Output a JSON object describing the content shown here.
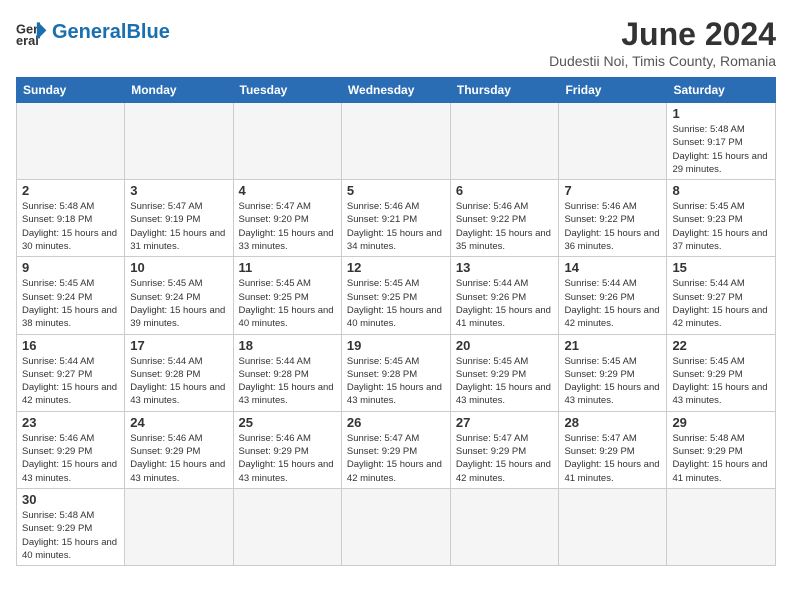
{
  "logo": {
    "general": "General",
    "blue": "Blue"
  },
  "header": {
    "title": "June 2024",
    "subtitle": "Dudestii Noi, Timis County, Romania"
  },
  "days_of_week": [
    "Sunday",
    "Monday",
    "Tuesday",
    "Wednesday",
    "Thursday",
    "Friday",
    "Saturday"
  ],
  "weeks": [
    [
      {
        "day": null
      },
      {
        "day": null
      },
      {
        "day": null
      },
      {
        "day": null
      },
      {
        "day": null
      },
      {
        "day": null
      },
      {
        "day": 1,
        "sunrise": "5:48 AM",
        "sunset": "9:17 PM",
        "daylight": "15 hours and 29 minutes."
      }
    ],
    [
      {
        "day": 2,
        "sunrise": "5:48 AM",
        "sunset": "9:18 PM",
        "daylight": "15 hours and 30 minutes."
      },
      {
        "day": 3,
        "sunrise": "5:47 AM",
        "sunset": "9:19 PM",
        "daylight": "15 hours and 31 minutes."
      },
      {
        "day": 4,
        "sunrise": "5:47 AM",
        "sunset": "9:20 PM",
        "daylight": "15 hours and 33 minutes."
      },
      {
        "day": 5,
        "sunrise": "5:46 AM",
        "sunset": "9:21 PM",
        "daylight": "15 hours and 34 minutes."
      },
      {
        "day": 6,
        "sunrise": "5:46 AM",
        "sunset": "9:22 PM",
        "daylight": "15 hours and 35 minutes."
      },
      {
        "day": 7,
        "sunrise": "5:46 AM",
        "sunset": "9:22 PM",
        "daylight": "15 hours and 36 minutes."
      },
      {
        "day": 8,
        "sunrise": "5:45 AM",
        "sunset": "9:23 PM",
        "daylight": "15 hours and 37 minutes."
      }
    ],
    [
      {
        "day": 9,
        "sunrise": "5:45 AM",
        "sunset": "9:24 PM",
        "daylight": "15 hours and 38 minutes."
      },
      {
        "day": 10,
        "sunrise": "5:45 AM",
        "sunset": "9:24 PM",
        "daylight": "15 hours and 39 minutes."
      },
      {
        "day": 11,
        "sunrise": "5:45 AM",
        "sunset": "9:25 PM",
        "daylight": "15 hours and 40 minutes."
      },
      {
        "day": 12,
        "sunrise": "5:45 AM",
        "sunset": "9:25 PM",
        "daylight": "15 hours and 40 minutes."
      },
      {
        "day": 13,
        "sunrise": "5:44 AM",
        "sunset": "9:26 PM",
        "daylight": "15 hours and 41 minutes."
      },
      {
        "day": 14,
        "sunrise": "5:44 AM",
        "sunset": "9:26 PM",
        "daylight": "15 hours and 42 minutes."
      },
      {
        "day": 15,
        "sunrise": "5:44 AM",
        "sunset": "9:27 PM",
        "daylight": "15 hours and 42 minutes."
      }
    ],
    [
      {
        "day": 16,
        "sunrise": "5:44 AM",
        "sunset": "9:27 PM",
        "daylight": "15 hours and 42 minutes."
      },
      {
        "day": 17,
        "sunrise": "5:44 AM",
        "sunset": "9:28 PM",
        "daylight": "15 hours and 43 minutes."
      },
      {
        "day": 18,
        "sunrise": "5:44 AM",
        "sunset": "9:28 PM",
        "daylight": "15 hours and 43 minutes."
      },
      {
        "day": 19,
        "sunrise": "5:45 AM",
        "sunset": "9:28 PM",
        "daylight": "15 hours and 43 minutes."
      },
      {
        "day": 20,
        "sunrise": "5:45 AM",
        "sunset": "9:29 PM",
        "daylight": "15 hours and 43 minutes."
      },
      {
        "day": 21,
        "sunrise": "5:45 AM",
        "sunset": "9:29 PM",
        "daylight": "15 hours and 43 minutes."
      },
      {
        "day": 22,
        "sunrise": "5:45 AM",
        "sunset": "9:29 PM",
        "daylight": "15 hours and 43 minutes."
      }
    ],
    [
      {
        "day": 23,
        "sunrise": "5:46 AM",
        "sunset": "9:29 PM",
        "daylight": "15 hours and 43 minutes."
      },
      {
        "day": 24,
        "sunrise": "5:46 AM",
        "sunset": "9:29 PM",
        "daylight": "15 hours and 43 minutes."
      },
      {
        "day": 25,
        "sunrise": "5:46 AM",
        "sunset": "9:29 PM",
        "daylight": "15 hours and 43 minutes."
      },
      {
        "day": 26,
        "sunrise": "5:47 AM",
        "sunset": "9:29 PM",
        "daylight": "15 hours and 42 minutes."
      },
      {
        "day": 27,
        "sunrise": "5:47 AM",
        "sunset": "9:29 PM",
        "daylight": "15 hours and 42 minutes."
      },
      {
        "day": 28,
        "sunrise": "5:47 AM",
        "sunset": "9:29 PM",
        "daylight": "15 hours and 41 minutes."
      },
      {
        "day": 29,
        "sunrise": "5:48 AM",
        "sunset": "9:29 PM",
        "daylight": "15 hours and 41 minutes."
      }
    ],
    [
      {
        "day": 30,
        "sunrise": "5:48 AM",
        "sunset": "9:29 PM",
        "daylight": "15 hours and 40 minutes."
      },
      {
        "day": null
      },
      {
        "day": null
      },
      {
        "day": null
      },
      {
        "day": null
      },
      {
        "day": null
      },
      {
        "day": null
      }
    ]
  ]
}
